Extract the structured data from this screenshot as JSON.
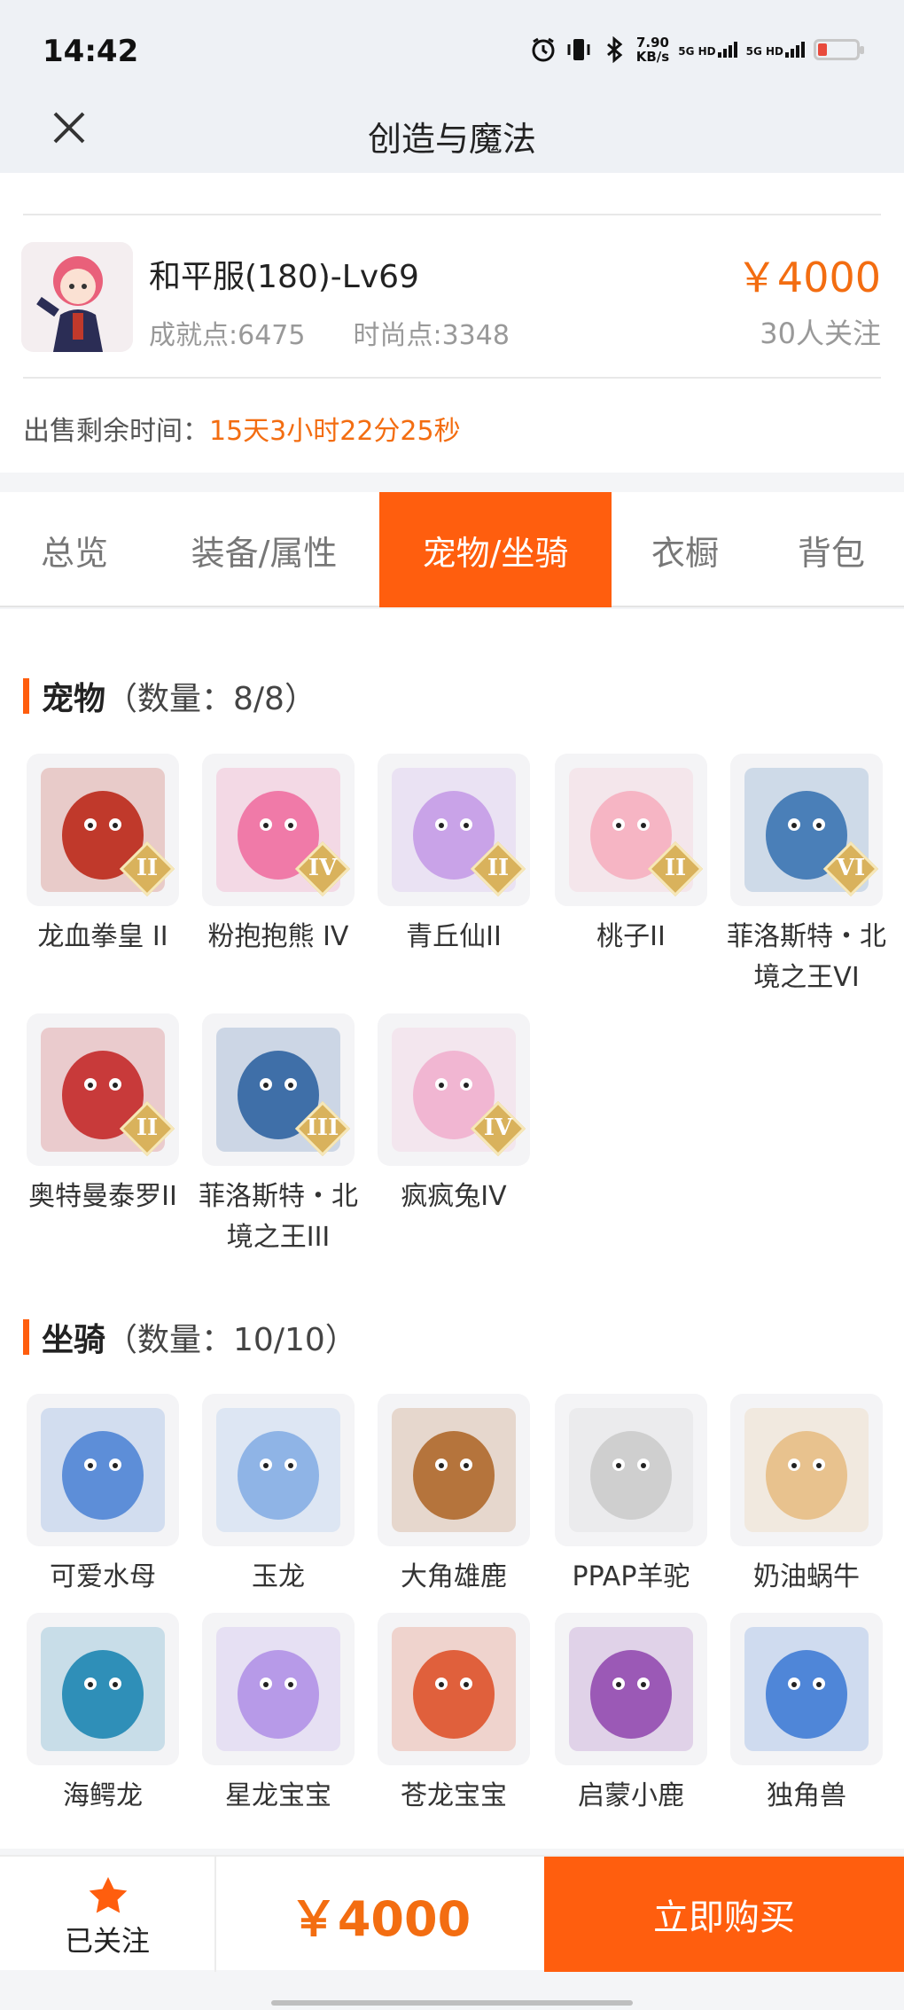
{
  "status_bar": {
    "time": "14:42",
    "speed_value": "7.90",
    "speed_unit": "KB/s",
    "net1": "5G HD",
    "net2": "5G HD"
  },
  "header": {
    "title": "创造与魔法"
  },
  "role": {
    "name": "和平服(180)-Lv69",
    "achievement": "成就点:6475",
    "fashion": "时尚点:3348",
    "price": "￥4000",
    "followers": "30人关注",
    "remain_label": "出售剩余时间：",
    "remain_value": "15天3小时22分25秒"
  },
  "tabs": [
    {
      "label": "总览"
    },
    {
      "label": "装备/属性"
    },
    {
      "label": "宠物/坐骑",
      "active": true
    },
    {
      "label": "衣橱"
    },
    {
      "label": "背包"
    }
  ],
  "pets": {
    "title": "宠物",
    "count": "（数量：8/8）",
    "items": [
      {
        "name": "龙血拳皇 II",
        "grade": "II",
        "color": "#c0392b"
      },
      {
        "name": "粉抱抱熊 IV",
        "grade": "IV",
        "color": "#f07aa8"
      },
      {
        "name": "青丘仙II",
        "grade": "II",
        "color": "#c9a3e8"
      },
      {
        "name": "桃子II",
        "grade": "II",
        "color": "#f6b5c4"
      },
      {
        "name": "菲洛斯特・北境之王VI",
        "grade": "VI",
        "color": "#4a7fb8"
      },
      {
        "name": "奥特曼泰罗II",
        "grade": "II",
        "color": "#c83a3a"
      },
      {
        "name": "菲洛斯特・北境之王III",
        "grade": "III",
        "color": "#3f6fa8"
      },
      {
        "name": "疯疯兔IV",
        "grade": "IV",
        "color": "#f1b6d2"
      }
    ]
  },
  "mounts": {
    "title": "坐骑",
    "count": "（数量：10/10）",
    "items": [
      {
        "name": "可爱水母",
        "color": "#5d8ed8"
      },
      {
        "name": "玉龙",
        "color": "#8fb4e6"
      },
      {
        "name": "大角雄鹿",
        "color": "#b5743c"
      },
      {
        "name": "PPAP羊驼",
        "color": "#cfcfcf"
      },
      {
        "name": "奶油蜗牛",
        "color": "#e8c28e"
      },
      {
        "name": "海鳄龙",
        "color": "#2f8fb8"
      },
      {
        "name": "星龙宝宝",
        "color": "#b79ae8"
      },
      {
        "name": "苍龙宝宝",
        "color": "#e0603c"
      },
      {
        "name": "启蒙小鹿",
        "color": "#9b59b6"
      },
      {
        "name": "独角兽",
        "color": "#4f86d8"
      }
    ]
  },
  "bottom": {
    "follow_label": "已关注",
    "price": "￥4000",
    "buy_label": "立即购买"
  },
  "colors": {
    "accent": "#ff5e0e",
    "price": "#f36d11"
  }
}
